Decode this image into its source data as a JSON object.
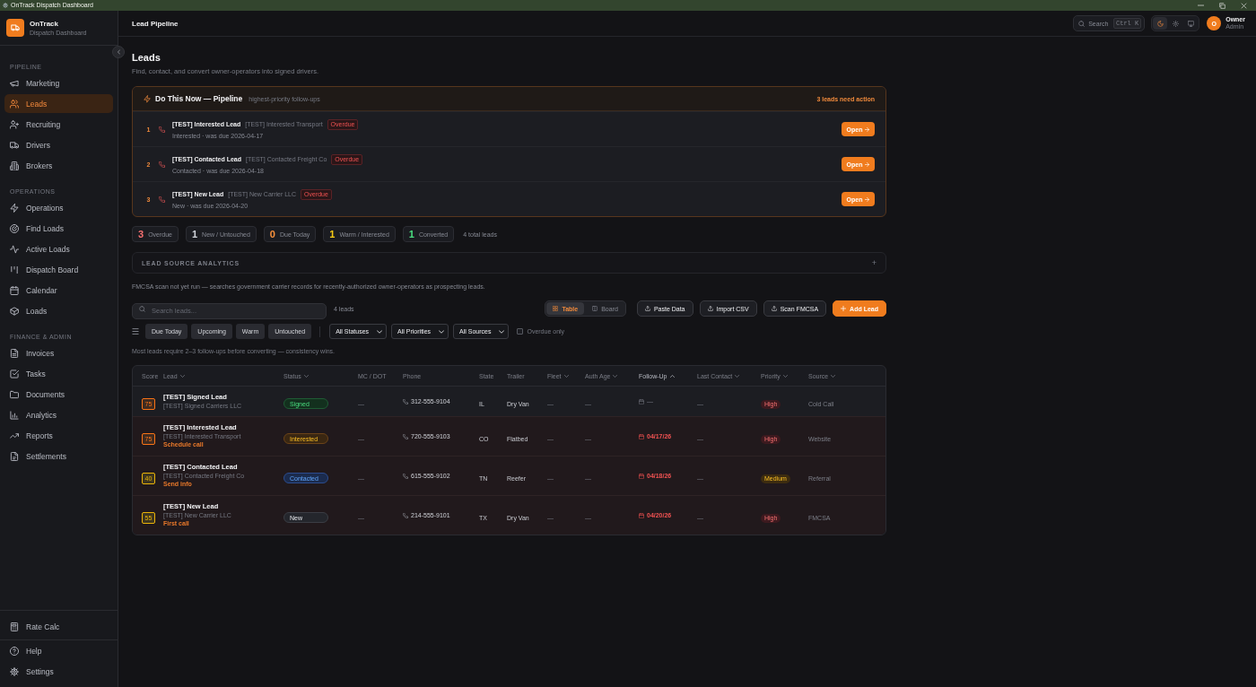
{
  "window": {
    "title": "OnTrack Dispatch Dashboard"
  },
  "brand": {
    "name": "OnTrack",
    "subtitle": "Dispatch Dashboard"
  },
  "sidebar": {
    "sections": [
      {
        "title": "PIPELINE",
        "items": [
          {
            "label": "Marketing",
            "selected": false
          },
          {
            "label": "Leads",
            "selected": true
          },
          {
            "label": "Recruiting",
            "selected": false
          },
          {
            "label": "Drivers",
            "selected": false
          },
          {
            "label": "Brokers",
            "selected": false
          }
        ]
      },
      {
        "title": "OPERATIONS",
        "items": [
          {
            "label": "Operations",
            "selected": false
          },
          {
            "label": "Find Loads",
            "selected": false
          },
          {
            "label": "Active Loads",
            "selected": false
          },
          {
            "label": "Dispatch Board",
            "selected": false
          },
          {
            "label": "Calendar",
            "selected": false
          },
          {
            "label": "Loads",
            "selected": false
          }
        ]
      },
      {
        "title": "FINANCE & ADMIN",
        "items": [
          {
            "label": "Invoices",
            "selected": false
          },
          {
            "label": "Tasks",
            "selected": false
          },
          {
            "label": "Documents",
            "selected": false
          },
          {
            "label": "Analytics",
            "selected": false
          },
          {
            "label": "Reports",
            "selected": false
          },
          {
            "label": "Settlements",
            "selected": false
          }
        ]
      }
    ],
    "tools": [
      {
        "label": "Rate Calc",
        "selected": false
      }
    ],
    "footer": [
      {
        "label": "Help",
        "selected": false
      },
      {
        "label": "Settings",
        "selected": false
      }
    ]
  },
  "header": {
    "title": "Lead Pipeline",
    "search": {
      "label": "Search",
      "shortcut": "Ctrl K"
    },
    "theme_options": [
      {
        "selected": true
      },
      {
        "selected": false
      },
      {
        "selected": false
      }
    ],
    "user": {
      "initial": "O",
      "name": "Owner",
      "role": "Admin"
    }
  },
  "page": {
    "title": "Leads",
    "subtitle": "Find, contact, and convert owner-operators into signed drivers."
  },
  "do_now": {
    "title": "Do This Now — Pipeline",
    "subtitle": "highest-priority follow-ups",
    "count": "3 leads need action",
    "items": [
      {
        "number": "1",
        "name": "[TEST] Interested Lead",
        "company": "[TEST] Interested Transport",
        "badge": "Overdue",
        "detail": "Interested · was due 2026-04-17",
        "button": "Open"
      },
      {
        "number": "2",
        "name": "[TEST] Contacted Lead",
        "company": "[TEST] Contacted Freight Co",
        "badge": "Overdue",
        "detail": "Contacted · was due 2026-04-18",
        "button": "Open"
      },
      {
        "number": "3",
        "name": "[TEST] New Lead",
        "company": "[TEST] New Carrier LLC",
        "badge": "Overdue",
        "detail": "New · was due 2026-04-20",
        "button": "Open"
      }
    ]
  },
  "stats": [
    {
      "value": "3",
      "label": "Overdue",
      "color": "#f87171"
    },
    {
      "value": "1",
      "label": "New / Untouched",
      "color": "#d1d5db"
    },
    {
      "value": "0",
      "label": "Due Today",
      "color": "#fb923c"
    },
    {
      "value": "1",
      "label": "Warm / Interested",
      "color": "#facc15"
    },
    {
      "value": "1",
      "label": "Converted",
      "color": "#4ade80"
    }
  ],
  "stats_total": "4 total leads",
  "analytics": {
    "title": "LEAD SOURCE ANALYTICS",
    "toggle": "+"
  },
  "fmcsa_note": "FMCSA scan not yet run — searches government carrier records for recently-authorized owner-operators as prospecting leads.",
  "toolbar": {
    "search": {
      "placeholder": "Search leads..."
    },
    "count": "4 leads",
    "views": [
      {
        "label": "Table",
        "selected": true
      },
      {
        "label": "Board",
        "selected": false
      }
    ],
    "actions": [
      {
        "label": "Paste Data",
        "kind": "secondary"
      },
      {
        "label": "Import CSV",
        "kind": "secondary"
      },
      {
        "label": "Scan FMCSA",
        "kind": "secondary"
      },
      {
        "label": "Add Lead",
        "kind": "primary"
      }
    ]
  },
  "filters": {
    "quick": [
      "Due Today",
      "Upcoming",
      "Warm",
      "Untouched"
    ],
    "selects": [
      "All Statuses",
      "All Priorities",
      "All Sources"
    ],
    "overdue_only": {
      "label": "Overdue only",
      "checked": false
    }
  },
  "hint": "Most leads require 2–3 follow-ups before converting — consistency wins.",
  "table": {
    "columns": [
      {
        "label": "Score",
        "sortable": false,
        "sorted": false
      },
      {
        "label": "Lead",
        "sortable": true,
        "sorted": false
      },
      {
        "label": "Status",
        "sortable": true,
        "sorted": false
      },
      {
        "label": "MC / DOT",
        "sortable": false,
        "sorted": false
      },
      {
        "label": "Phone",
        "sortable": false,
        "sorted": false
      },
      {
        "label": "State",
        "sortable": false,
        "sorted": false
      },
      {
        "label": "Trailer",
        "sortable": false,
        "sorted": false
      },
      {
        "label": "Fleet",
        "sortable": true,
        "sorted": false
      },
      {
        "label": "Auth Age",
        "sortable": true,
        "sorted": false
      },
      {
        "label": "Follow-Up",
        "sortable": true,
        "sorted": true
      },
      {
        "label": "Last Contact",
        "sortable": true,
        "sorted": false
      },
      {
        "label": "Priority",
        "sortable": true,
        "sorted": false
      },
      {
        "label": "Source",
        "sortable": true,
        "sorted": false
      }
    ],
    "rows": [
      {
        "score": {
          "value": "75",
          "color": "#f97316"
        },
        "name": "[TEST] Signed Lead",
        "company": "[TEST] Signed Carriers LLC",
        "status": {
          "label": "Signed",
          "kind": "signed"
        },
        "mc_dot": "—",
        "phone": "312-555-9104",
        "state": "IL",
        "trailer": "Dry Van",
        "fleet": "—",
        "auth_age": "—",
        "follow_up": "—",
        "overdue": false,
        "last_contact": "—",
        "priority": {
          "label": "High",
          "kind": "high"
        },
        "source": "Cold Call"
      },
      {
        "score": {
          "value": "75",
          "color": "#f97316"
        },
        "name": "[TEST] Interested Lead",
        "company": "[TEST] Interested Transport",
        "action": "Schedule call",
        "status": {
          "label": "Interested",
          "kind": "interested"
        },
        "mc_dot": "—",
        "phone": "720-555-9103",
        "state": "CO",
        "trailer": "Flatbed",
        "fleet": "—",
        "auth_age": "—",
        "follow_up": "04/17/26",
        "overdue": true,
        "last_contact": "—",
        "priority": {
          "label": "High",
          "kind": "high"
        },
        "source": "Website"
      },
      {
        "score": {
          "value": "40",
          "color": "#eab308"
        },
        "name": "[TEST] Contacted Lead",
        "company": "[TEST] Contacted Freight Co",
        "action": "Send info",
        "status": {
          "label": "Contacted",
          "kind": "contacted"
        },
        "mc_dot": "—",
        "phone": "615-555-9102",
        "state": "TN",
        "trailer": "Reefer",
        "fleet": "—",
        "auth_age": "—",
        "follow_up": "04/18/26",
        "overdue": true,
        "last_contact": "—",
        "priority": {
          "label": "Medium",
          "kind": "medium"
        },
        "source": "Referral"
      },
      {
        "score": {
          "value": "55",
          "color": "#eab308"
        },
        "name": "[TEST] New Lead",
        "company": "[TEST] New Carrier LLC",
        "action": "First call",
        "status": {
          "label": "New",
          "kind": "new"
        },
        "mc_dot": "—",
        "phone": "214-555-9101",
        "state": "TX",
        "trailer": "Dry Van",
        "fleet": "—",
        "auth_age": "—",
        "follow_up": "04/20/26",
        "overdue": true,
        "last_contact": "—",
        "priority": {
          "label": "High",
          "kind": "high"
        },
        "source": "FMCSA"
      }
    ]
  }
}
